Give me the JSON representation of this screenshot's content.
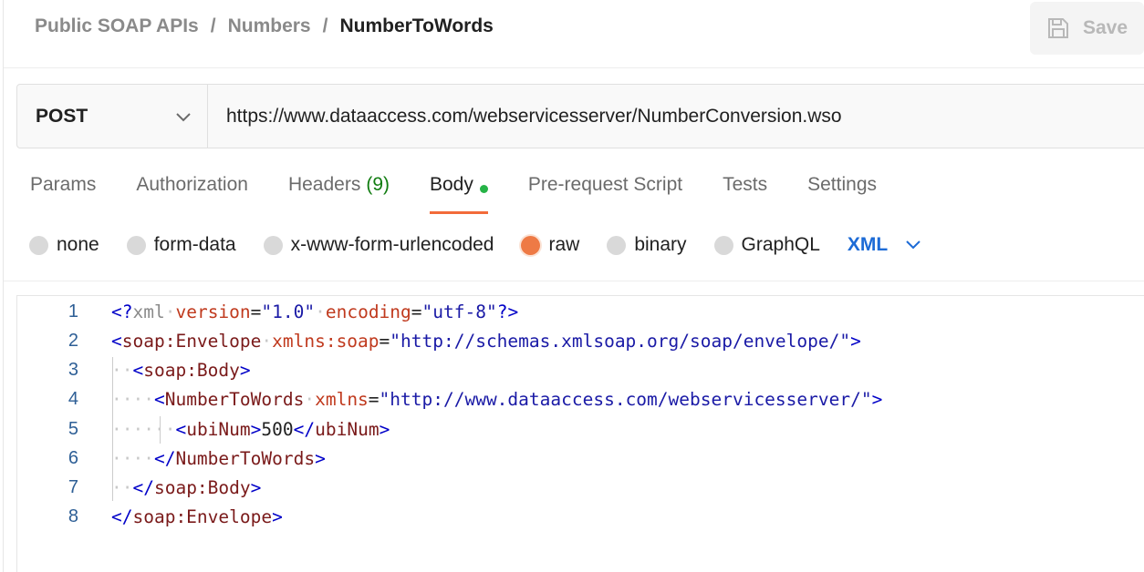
{
  "breadcrumb": {
    "items": [
      "Public SOAP APIs",
      "Numbers"
    ],
    "separator": "/",
    "current": "NumberToWords"
  },
  "toolbar": {
    "save_label": "Save",
    "save_icon": "save-icon"
  },
  "request": {
    "method": "POST",
    "url": "https://www.dataaccess.com/webservicesserver/NumberConversion.wso"
  },
  "tabs": [
    {
      "label": "Params"
    },
    {
      "label": "Authorization"
    },
    {
      "label": "Headers",
      "count": "(9)"
    },
    {
      "label": "Body",
      "active": true,
      "indicator": "green-dot"
    },
    {
      "label": "Pre-request Script"
    },
    {
      "label": "Tests"
    },
    {
      "label": "Settings"
    }
  ],
  "body_types": {
    "options": [
      "none",
      "form-data",
      "x-www-form-urlencoded",
      "raw",
      "binary",
      "GraphQL"
    ],
    "selected": "raw",
    "format": "XML"
  },
  "editor": {
    "line_numbers": [
      "1",
      "2",
      "3",
      "4",
      "5",
      "6",
      "7",
      "8"
    ],
    "lines": [
      "<?xml version=\"1.0\" encoding=\"utf-8\"?>",
      "<soap:Envelope xmlns:soap=\"http://schemas.xmlsoap.org/soap/envelope/\">",
      "  <soap:Body>",
      "    <NumberToWords xmlns=\"http://www.dataaccess.com/webservicesserver/\">",
      "      <ubiNum>500</ubiNum>",
      "    </NumberToWords>",
      "  </soap:Body>",
      "</soap:Envelope>"
    ]
  },
  "colors": {
    "accent": "#f26b3a",
    "link": "#1d6bd6",
    "count_green": "#107c10"
  }
}
